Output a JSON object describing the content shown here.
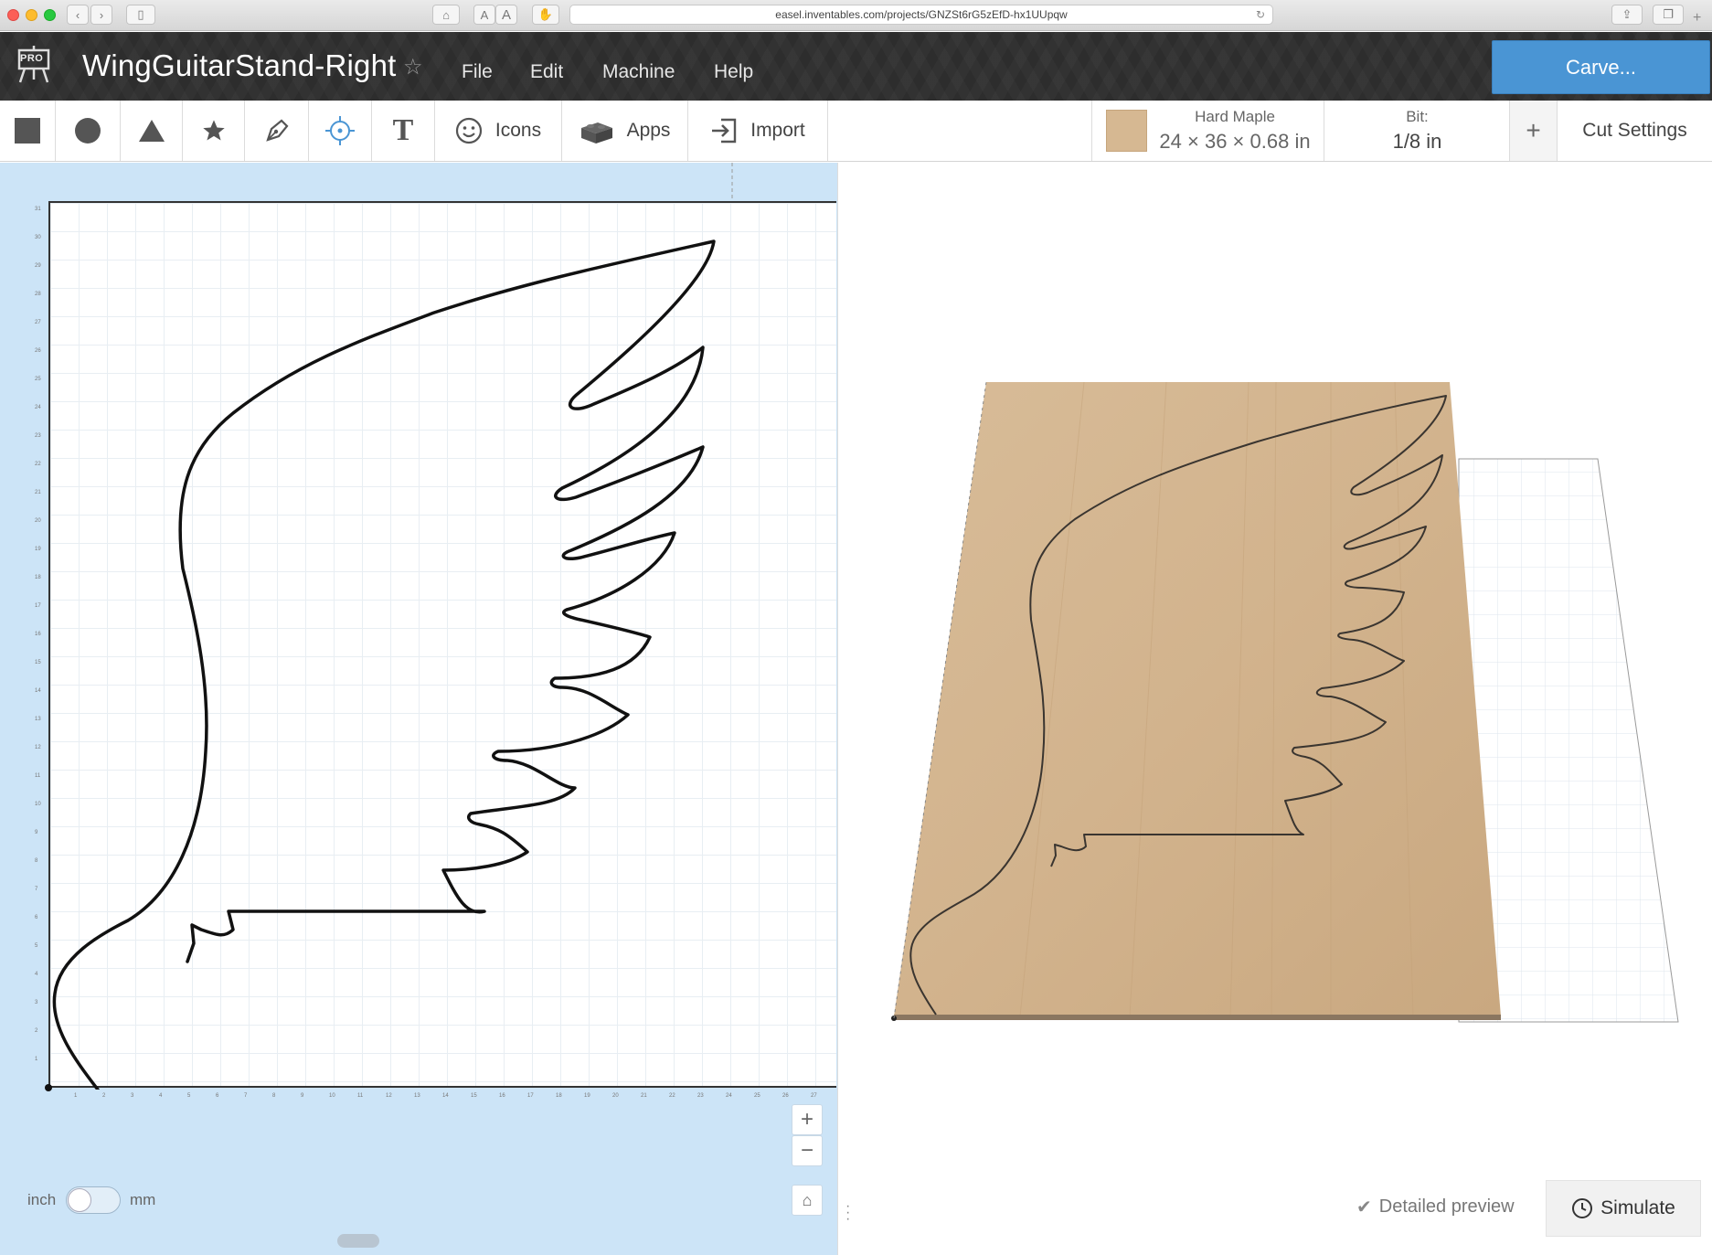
{
  "browser": {
    "url": "easel.inventables.com/projects/GNZSt6rG5zEfD-hx1UUpqw",
    "text_small": "A",
    "text_large": "A"
  },
  "header": {
    "badge": "PRO",
    "project_title": "WingGuitarStand-Right",
    "menus": [
      "File",
      "Edit",
      "Machine",
      "Help"
    ],
    "carve_label": "Carve..."
  },
  "toolbar": {
    "icons_label": "Icons",
    "apps_label": "Apps",
    "import_label": "Import",
    "text_tool": "T"
  },
  "material": {
    "name": "Hard Maple",
    "dimensions": "24 × 36 × 0.68 in",
    "bit_label": "Bit:",
    "bit_value": "1/8 in",
    "add_label": "+",
    "cut_settings_label": "Cut Settings"
  },
  "design": {
    "unit_left": "inch",
    "unit_right": "mm",
    "x_ticks": [
      "1",
      "2",
      "3",
      "4",
      "5",
      "6",
      "7",
      "8",
      "9",
      "10",
      "11",
      "12",
      "13",
      "14",
      "15",
      "16",
      "17",
      "18",
      "19",
      "20",
      "21",
      "22",
      "23",
      "24",
      "25",
      "26",
      "27"
    ],
    "y_ticks": [
      "1",
      "2",
      "3",
      "4",
      "5",
      "6",
      "7",
      "8",
      "9",
      "10",
      "11",
      "12",
      "13",
      "14",
      "15",
      "16",
      "17",
      "18",
      "19",
      "20",
      "21",
      "22",
      "23",
      "24",
      "25",
      "26",
      "27",
      "28",
      "29",
      "30",
      "31"
    ]
  },
  "preview": {
    "detailed_label": "Detailed preview",
    "simulate_label": "Simulate"
  },
  "colors": {
    "carve_button": "#4a95d4",
    "header_bg": "#2d2d2d",
    "design_bg": "#cce4f7",
    "wood": "#d6b892"
  }
}
